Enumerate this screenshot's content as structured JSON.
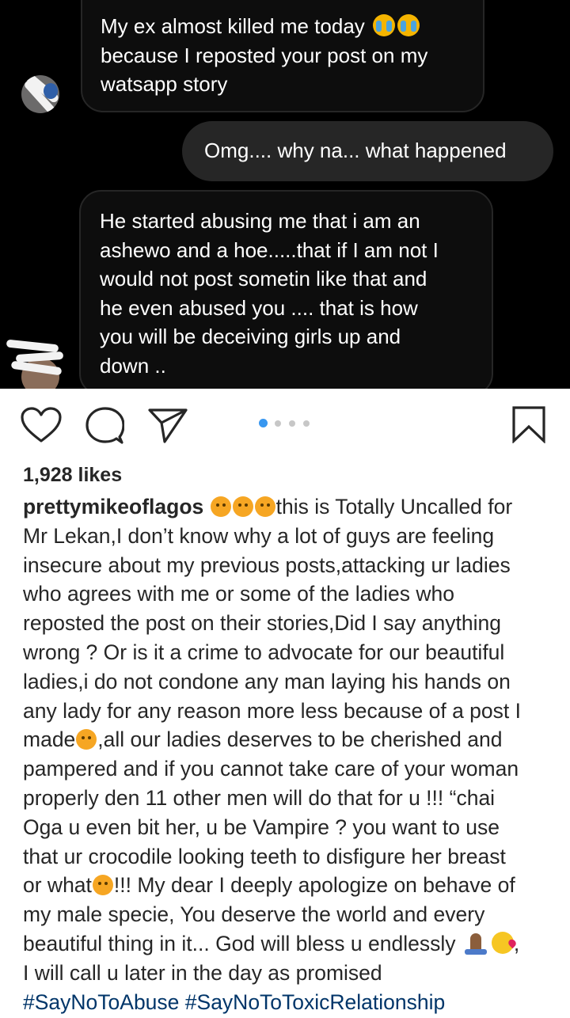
{
  "chat": {
    "messages": [
      {
        "direction": "incoming",
        "lines": [
          "My ex almost killed me today",
          "because I reposted your post on my",
          "watsapp story"
        ],
        "emoji": [
          "crying-face",
          "crying-face"
        ]
      },
      {
        "direction": "outgoing",
        "lines": [
          "Omg.... why na... what happened"
        ]
      },
      {
        "direction": "incoming",
        "lines": [
          "He started abusing me that i am an",
          "ashewo and a hoe.....that if I am not I",
          "would not post sometin like that and",
          "he even abused you .... that is how",
          "you will be deceiving girls up and",
          "down .."
        ]
      }
    ]
  },
  "post": {
    "carousel": {
      "count": 4,
      "active_index": 0
    },
    "likes": "1,928 likes",
    "username": "prettymikeoflagos",
    "caption_lines": [
      "this is Totally Uncalled for",
      "Mr Lekan,I don’t know why a lot of guys are feeling",
      "insecure about my previous posts,attacking ur ladies",
      "who agrees with me or some of the ladies who",
      "reposted the post on their stories,Did I say anything",
      "wrong ? Or is it a crime to advocate for our beautiful",
      "ladies,i do not condone any man laying his hands on",
      "any lady for any reason more less because of a post I",
      "made",
      ",all our ladies deserves to be cherished and",
      "pampered and if you cannot take care of your woman",
      "properly den 11 other men will do that for u !!! “chai",
      "Oga u even bit her, u be Vampire ? you want to use",
      "that ur crocodile looking teeth to disfigure her breast",
      "or what",
      "!!! My dear I deeply apologize on behave of",
      "my male specie, You deserve the world and every",
      "beautiful thing in it... God will bless u endlessly",
      ",",
      "I will call u later in the day as promised"
    ],
    "hashtags": [
      "#SayNoToAbuse",
      "#SayNoToToxicRelationship"
    ]
  },
  "colors": {
    "link_blue": "#003569",
    "carousel_active": "#3897f0",
    "chat_background": "#000000",
    "outgoing_bubble": "#262626"
  },
  "icons": [
    "heart-icon",
    "comment-icon",
    "share-icon",
    "bookmark-icon",
    "crying-face-emoji",
    "persevering-face-emoji",
    "folded-hands-emoji",
    "face-blowing-kiss-emoji"
  ]
}
